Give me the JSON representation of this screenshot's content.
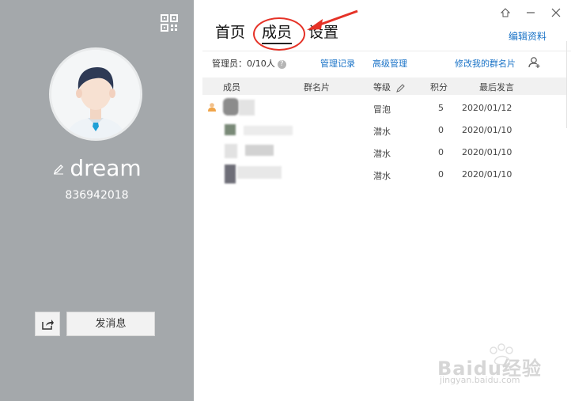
{
  "profile": {
    "nickname": "dream",
    "group_id": "836942018",
    "send_message_label": "发消息"
  },
  "tabs": [
    {
      "label": "首页",
      "active": false
    },
    {
      "label": "成员",
      "active": true
    },
    {
      "label": "设置",
      "active": false
    }
  ],
  "header": {
    "edit_profile_label": "编辑资料"
  },
  "toolbar": {
    "admin_count": "管理员：0/10人",
    "help_glyph": "?",
    "manage_log": "管理记录",
    "advanced_manage": "高级管理",
    "edit_group_card": "修改我的群名片"
  },
  "members_table": {
    "columns": [
      "成员",
      "群名片",
      "等级",
      "积分",
      "最后发言"
    ],
    "rows": [
      {
        "level": "冒泡",
        "points": "5",
        "last_speak": "2020/01/12",
        "is_owner": true
      },
      {
        "level": "潜水",
        "points": "0",
        "last_speak": "2020/01/10",
        "is_owner": false
      },
      {
        "level": "潜水",
        "points": "0",
        "last_speak": "2020/01/10",
        "is_owner": false
      },
      {
        "level": "潜水",
        "points": "0",
        "last_speak": "2020/01/10",
        "is_owner": false
      }
    ]
  },
  "watermark": {
    "brand": "Baidu经验",
    "url": "jingyan.baidu.com"
  },
  "colors": {
    "left_panel": "#a4a8ab",
    "link": "#1a73c7",
    "annotation": "#e53227"
  }
}
